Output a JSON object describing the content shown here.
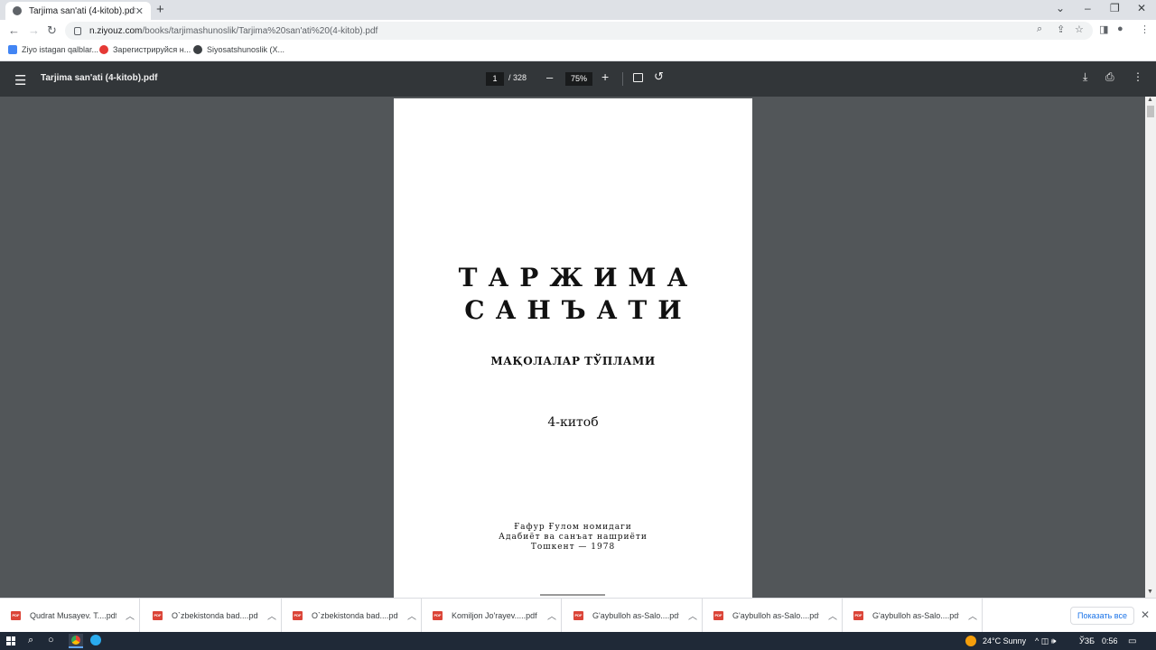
{
  "browser": {
    "tab_title": "Tarjima san'ati (4-kitob).pdf",
    "tab_close": "✕",
    "new_tab": "+",
    "url_host": "n.ziyouz.com",
    "url_path": "/books/tarjimashunoslik/Tarjima%20san'ati%20(4-kitob).pdf",
    "window_controls": [
      "⌄",
      "–",
      "❐",
      "✕"
    ],
    "nav": {
      "back": "←",
      "forward": "→",
      "reload": "↻"
    },
    "omnibox_icons": [
      "zoom-icon",
      "share-icon",
      "star-icon"
    ],
    "bookmarks": [
      {
        "label": "Ziyo istagan qalblar...",
        "icon": "ziyo-icon",
        "color": "#4285f4"
      },
      {
        "label": "Зарегистрируйся н...",
        "icon": "heart-icon",
        "color": "#e53935"
      },
      {
        "label": "Siyosatshunoslik (X...",
        "icon": "globe-icon",
        "color": "#3c4043"
      }
    ]
  },
  "pdf_toolbar": {
    "file_name": "Tarjima san'ati (4-kitob).pdf",
    "current_page": "1",
    "total_pages": "/ 328",
    "zoom": "75%",
    "zoom_out": "–",
    "zoom_in": "+"
  },
  "pdf_page": {
    "title_line1": "ТАРЖИМА",
    "title_line2": "САНЪАТИ",
    "subtitle": "МАҚОЛАЛАР ТЎПЛАМИ",
    "volume": "4-китоб",
    "publisher_line1": "Ғафур Ғулом номидаги",
    "publisher_line2": "Адабиёт ва санъат нашриёти",
    "publisher_line3": "Тошкент — 1978"
  },
  "downloads": {
    "items": [
      "Qudrat Musayev. T....pdf",
      "O`zbekistonda bad....pdf",
      "O`zbekistonda bad....pdf",
      "Komiljon Jo'rayev.....pdf",
      "G'aybulloh as-Salo....pdf",
      "G'aybulloh as-Salo....pdf",
      "G'aybulloh as-Salo....pdf"
    ],
    "show_all": "Показать все",
    "close": "✕"
  },
  "taskbar": {
    "weather": "24°C  Sunny",
    "lang": "ЎЗБ",
    "time": "0:56",
    "tray": "^  ◫  🕪"
  },
  "colors": {
    "pdf_toolbar_bg": "#323639",
    "viewer_bg": "#525659",
    "accent": "#1a73e8",
    "pdf_icon": "#db4437"
  }
}
